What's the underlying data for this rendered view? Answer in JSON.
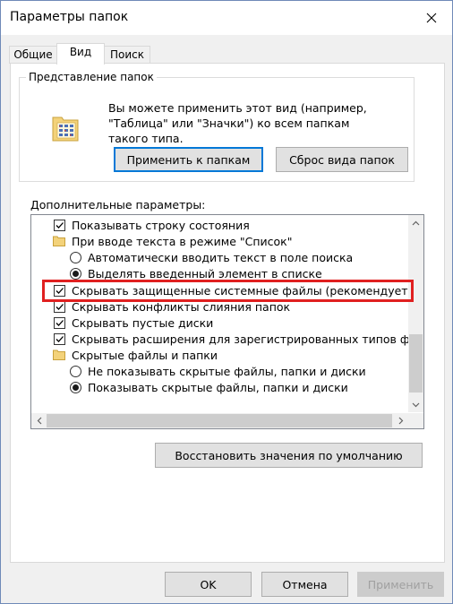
{
  "window": {
    "title": "Параметры папок"
  },
  "tabs": [
    {
      "label": "Общие",
      "active": false
    },
    {
      "label": "Вид",
      "active": true
    },
    {
      "label": "Поиск",
      "active": false
    }
  ],
  "folder_view": {
    "group_label": "Представление папок",
    "description_lines": [
      "Вы можете применить этот вид (например,",
      "\"Таблица\" или \"Значки\") ко всем папкам",
      "такого типа."
    ],
    "apply_button": "Применить к папкам",
    "reset_button": "Сброс вида папок"
  },
  "advanced": {
    "label": "Дополнительные параметры:",
    "items": [
      {
        "type": "checkbox",
        "checked": true,
        "level": 0,
        "label": "Показывать строку состояния"
      },
      {
        "type": "folder",
        "level": 0,
        "label": "При вводе текста в режиме \"Список\""
      },
      {
        "type": "radio",
        "checked": false,
        "level": 1,
        "label": "Автоматически вводить текст в поле поиска"
      },
      {
        "type": "radio",
        "checked": true,
        "level": 1,
        "label": "Выделять введенный элемент в списке"
      },
      {
        "type": "checkbox",
        "checked": true,
        "level": 0,
        "label": "Скрывать защищенные системные файлы (рекомендуетс"
      },
      {
        "type": "checkbox",
        "checked": true,
        "level": 0,
        "label": "Скрывать конфликты слияния папок"
      },
      {
        "type": "checkbox",
        "checked": true,
        "level": 0,
        "label": "Скрывать пустые диски"
      },
      {
        "type": "checkbox",
        "checked": true,
        "level": 0,
        "label": "Скрывать расширения для зарегистрированных типов фа"
      },
      {
        "type": "folder",
        "level": 0,
        "label": "Скрытые файлы и папки"
      },
      {
        "type": "radio",
        "checked": false,
        "level": 1,
        "label": "Не показывать скрытые файлы, папки и диски"
      },
      {
        "type": "radio",
        "checked": true,
        "level": 1,
        "label": "Показывать скрытые файлы, папки и диски"
      }
    ],
    "restore_button": "Восстановить значения по умолчанию"
  },
  "footer": {
    "ok": "OK",
    "cancel": "Отмена",
    "apply": "Применить"
  },
  "colors": {
    "highlight": "#e02020",
    "focus": "#0078d7"
  }
}
